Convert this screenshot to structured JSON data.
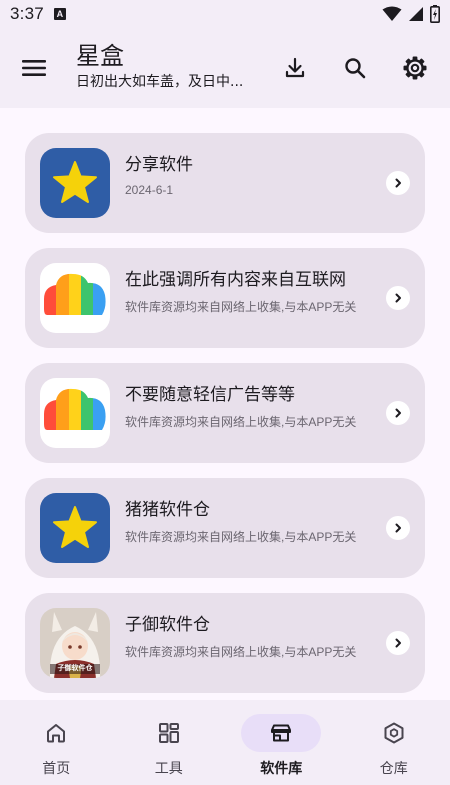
{
  "status_bar": {
    "time": "3:37",
    "notif_letter": "A"
  },
  "app_bar": {
    "title": "星盒",
    "subtitle": "日初出大如车盖，及日中..."
  },
  "list": [
    {
      "title": "分享软件",
      "subtitle": "2024-6-1",
      "icon": "star-app-icon"
    },
    {
      "title": "在此强调所有内容来自互联网",
      "subtitle": "软件库资源均来自网络上收集,与本APP无关",
      "icon": "rainbow-cloud-icon"
    },
    {
      "title": "不要随意轻信广告等等",
      "subtitle": "软件库资源均来自网络上收集,与本APP无关",
      "icon": "rainbow-cloud-icon"
    },
    {
      "title": "猪猪软件仓",
      "subtitle": "软件库资源均来自网络上收集,与本APP无关",
      "icon": "star-app-icon"
    },
    {
      "title": "子御软件仓",
      "subtitle": "软件库资源均来自网络上收集,与本APP无关",
      "icon": "anime-avatar-icon",
      "icon_caption": "子御软件仓"
    }
  ],
  "bottom_nav": [
    {
      "label": "首页",
      "icon": "home-icon",
      "active": false
    },
    {
      "label": "工具",
      "icon": "grid-icon",
      "active": false
    },
    {
      "label": "软件库",
      "icon": "store-icon",
      "active": true
    },
    {
      "label": "仓库",
      "icon": "box-icon",
      "active": false
    }
  ],
  "colors": {
    "background": "#fdf7ff",
    "bar": "#f3edf7",
    "card": "#e8e0eb",
    "active_pill": "#e8def8",
    "star_bg": "#2f5da6",
    "star": "#f5d20a"
  }
}
